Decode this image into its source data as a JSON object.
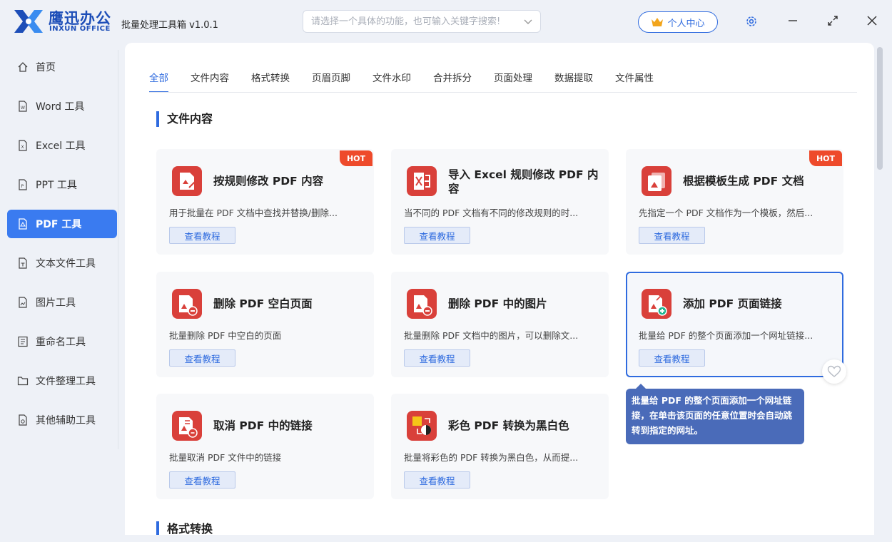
{
  "app": {
    "brand_cn": "鹰迅办公",
    "brand_en": "INXUN OFFICE",
    "title": "批量处理工具箱 v1.0.1"
  },
  "search": {
    "placeholder": "请选择一个具体的功能，也可输入关键字搜索!"
  },
  "header": {
    "user_center": "个人中心"
  },
  "sidebar": {
    "items": [
      {
        "label": "首页",
        "icon": "home-icon"
      },
      {
        "label": "Word 工具",
        "icon": "word-file-icon"
      },
      {
        "label": "Excel 工具",
        "icon": "excel-file-icon"
      },
      {
        "label": "PPT 工具",
        "icon": "ppt-file-icon"
      },
      {
        "label": "PDF 工具",
        "icon": "pdf-file-icon",
        "active": true
      },
      {
        "label": "文本文件工具",
        "icon": "text-file-icon"
      },
      {
        "label": "图片工具",
        "icon": "image-file-icon"
      },
      {
        "label": "重命名工具",
        "icon": "rename-icon"
      },
      {
        "label": "文件整理工具",
        "icon": "folder-icon"
      },
      {
        "label": "其他辅助工具",
        "icon": "misc-tool-icon"
      }
    ]
  },
  "tabs": [
    "全部",
    "文件内容",
    "格式转换",
    "页眉页脚",
    "文件水印",
    "合并拆分",
    "页面处理",
    "数据提取",
    "文件属性"
  ],
  "sections": {
    "content": "文件内容",
    "format": "格式转换"
  },
  "cards": [
    {
      "title": "按规则修改 PDF 内容",
      "desc": "用于批量在 PDF 文档中查找并替换/删除...",
      "button": "查看教程",
      "hot": "HOT"
    },
    {
      "title": "导入 Excel 规则修改 PDF 内容",
      "desc": "当不同的 PDF 文档有不同的修改规则的时...",
      "button": "查看教程"
    },
    {
      "title": "根据模板生成 PDF 文档",
      "desc": "先指定一个 PDF 文档作为一个模板，然后...",
      "button": "查看教程",
      "hot": "HOT"
    },
    {
      "title": "删除 PDF 空白页面",
      "desc": "批量删除 PDF 中空白的页面",
      "button": "查看教程"
    },
    {
      "title": "删除 PDF 中的图片",
      "desc": "批量删除 PDF 文档中的图片，可以删除文...",
      "button": "查看教程"
    },
    {
      "title": "添加 PDF 页面链接",
      "desc": "批量给 PDF 的整个页面添加一个网址链接...",
      "button": "查看教程"
    },
    {
      "title": "取消 PDF 中的链接",
      "desc": "批量取消 PDF 文件中的链接",
      "button": "查看教程"
    },
    {
      "title": "彩色 PDF 转换为黑白色",
      "desc": "批量将彩色的 PDF 转换为黑白色，从而提...",
      "button": "查看教程"
    }
  ],
  "tooltip": "批量给 PDF 的整个页面添加一个网址链接，在单击该页面的任意位置时会自动跳转到指定的网址。",
  "colors": {
    "accent": "#2f6bdf",
    "pdf_red": "#d9403a",
    "hot": "#ee4a2b",
    "tooltip_bg": "#4a6bb9"
  }
}
